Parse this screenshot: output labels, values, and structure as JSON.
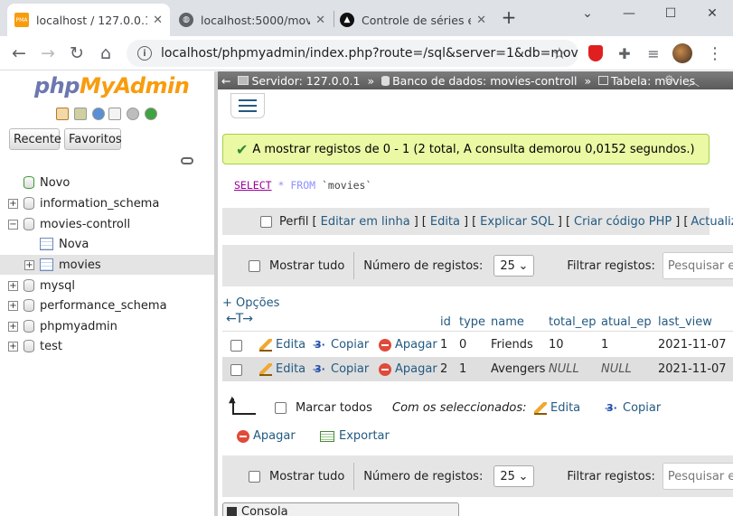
{
  "browser": {
    "tabs": [
      {
        "title": "localhost / 127.0.0.1 /",
        "favicon_text": "PMA",
        "active": true
      },
      {
        "title": "localhost:5000/movie",
        "active": false
      },
      {
        "title": "Controle de séries e f",
        "active": false
      }
    ],
    "new_tab_symbol": "+",
    "url": "localhost/phpmyadmin/index.php?route=/sql&server=1&db=movi...",
    "window_controls": [
      "chevron-down-icon",
      "minimize-icon",
      "maximize-icon",
      "close-icon"
    ]
  },
  "sidebar": {
    "logo_part1": "php",
    "logo_part2": "MyAdmin",
    "recent_label": "Recente",
    "favorites_label": "Favoritos",
    "tree": [
      {
        "label": "Novo",
        "level": 0,
        "kind": "new"
      },
      {
        "label": "information_schema",
        "level": 0,
        "kind": "db",
        "toggle": "+"
      },
      {
        "label": "movies-controll",
        "level": 0,
        "kind": "db",
        "toggle": "−"
      },
      {
        "label": "Nova",
        "level": 1,
        "kind": "new-table"
      },
      {
        "label": "movies",
        "level": 1,
        "kind": "table",
        "toggle": "+",
        "selected": true
      },
      {
        "label": "mysql",
        "level": 0,
        "kind": "db",
        "toggle": "+"
      },
      {
        "label": "performance_schema",
        "level": 0,
        "kind": "db",
        "toggle": "+"
      },
      {
        "label": "phpmyadmin",
        "level": 0,
        "kind": "db",
        "toggle": "+"
      },
      {
        "label": "test",
        "level": 0,
        "kind": "db",
        "toggle": "+"
      }
    ]
  },
  "breadcrumb": {
    "back_arrow": "←",
    "server": "Servidor: 127.0.0.1",
    "database": "Banco de dados: movies-controll",
    "table": "Tabela: movies",
    "sep": "»"
  },
  "result": {
    "message": "A mostrar registos de 0 - 1 (2 total, A consulta demorou 0,0152 segundos.)",
    "sql_kw": "SELECT",
    "sql_star": "*",
    "sql_from": "FROM",
    "sql_table": "`movies`"
  },
  "sql_links": {
    "profile": "Perfil",
    "edit_inline": "Editar em linha",
    "edit": "Edita",
    "explain": "Explicar SQL",
    "create_php": "Criar código PHP",
    "refresh": "Actualizar",
    "lb": "[",
    "rb": "]"
  },
  "nav": {
    "show_all": "Mostrar tudo",
    "num_rows_label": "Número de registos:",
    "num_rows_value": "25",
    "filter_label": "Filtrar registos:",
    "search_placeholder": "Pesquisar esta tabela"
  },
  "options_link": "+ Opções",
  "table": {
    "headers": [
      "id",
      "type",
      "name",
      "total_ep",
      "atual_ep",
      "last_view"
    ],
    "row_actions": {
      "edit": "Edita",
      "copy": "Copiar",
      "delete": "Apagar"
    },
    "rows": [
      {
        "id": "1",
        "type": "0",
        "name": "Friends",
        "total_ep": "10",
        "atual_ep": "1",
        "last_view": "2021-11-07"
      },
      {
        "id": "2",
        "type": "1",
        "name": "Avengers",
        "total_ep": "NULL",
        "atual_ep": "NULL",
        "last_view": "2021-11-07"
      }
    ]
  },
  "bulk": {
    "check_all": "Marcar todos",
    "with_selected": "Com os seleccionados:",
    "edit": "Edita",
    "copy": "Copiar",
    "delete": "Apagar",
    "export": "Exportar"
  },
  "console_label": "Consola",
  "colors": {
    "top_bar": "#666666",
    "success_bg": "#ebf8a4",
    "link": "#235a81",
    "row_alt": "#dfdfdf",
    "logo_php": "#6c78af",
    "logo_myadmin": "#f89c0e"
  }
}
